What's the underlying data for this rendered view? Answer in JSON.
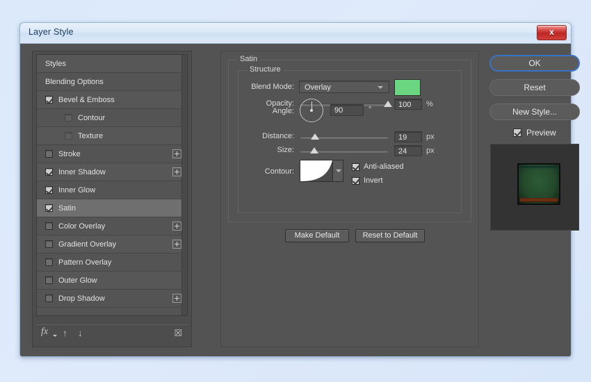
{
  "window": {
    "title": "Layer Style",
    "close_label": "x"
  },
  "styles_panel": {
    "items": [
      {
        "label": "Styles",
        "checkbox": "none",
        "indent": false,
        "plus": false,
        "selected": false
      },
      {
        "label": "Blending Options",
        "checkbox": "none",
        "indent": false,
        "plus": false,
        "selected": false
      },
      {
        "label": "Bevel & Emboss",
        "checkbox": "checked",
        "indent": false,
        "plus": false,
        "selected": false
      },
      {
        "label": "Contour",
        "checkbox": "dim",
        "indent": true,
        "plus": false,
        "selected": false
      },
      {
        "label": "Texture",
        "checkbox": "dim",
        "indent": true,
        "plus": false,
        "selected": false
      },
      {
        "label": "Stroke",
        "checkbox": "empty",
        "indent": false,
        "plus": true,
        "selected": false
      },
      {
        "label": "Inner Shadow",
        "checkbox": "checked",
        "indent": false,
        "plus": true,
        "selected": false
      },
      {
        "label": "Inner Glow",
        "checkbox": "checked",
        "indent": false,
        "plus": false,
        "selected": false
      },
      {
        "label": "Satin",
        "checkbox": "checked",
        "indent": false,
        "plus": false,
        "selected": true
      },
      {
        "label": "Color Overlay",
        "checkbox": "empty",
        "indent": false,
        "plus": true,
        "selected": false
      },
      {
        "label": "Gradient Overlay",
        "checkbox": "empty",
        "indent": false,
        "plus": true,
        "selected": false
      },
      {
        "label": "Pattern Overlay",
        "checkbox": "empty",
        "indent": false,
        "plus": false,
        "selected": false
      },
      {
        "label": "Outer Glow",
        "checkbox": "empty",
        "indent": false,
        "plus": false,
        "selected": false
      },
      {
        "label": "Drop Shadow",
        "checkbox": "empty",
        "indent": false,
        "plus": true,
        "selected": false
      }
    ],
    "toolbar": {
      "fx_label": "fx",
      "up_label": "↑",
      "down_label": "↓",
      "trash_label": "☒"
    }
  },
  "satin": {
    "group_title": "Satin",
    "structure_title": "Structure",
    "blend_mode": {
      "label": "Blend Mode:",
      "value": "Overlay",
      "color": "#6bd680"
    },
    "opacity": {
      "label": "Opacity:",
      "value": "100",
      "unit": "%",
      "percent": 100
    },
    "angle": {
      "label": "Angle:",
      "value": "90",
      "unit": "°"
    },
    "distance": {
      "label": "Distance:",
      "value": "19",
      "unit": "px",
      "percent": 17
    },
    "size": {
      "label": "Size:",
      "value": "24",
      "unit": "px",
      "percent": 16
    },
    "contour": {
      "label": "Contour:",
      "anti_aliased_label": "Anti-aliased",
      "anti_aliased_checked": true,
      "invert_label": "Invert",
      "invert_checked": true
    },
    "make_default_label": "Make Default",
    "reset_default_label": "Reset to Default"
  },
  "actions": {
    "ok_label": "OK",
    "reset_label": "Reset",
    "new_style_label": "New Style...",
    "preview_label": "Preview",
    "preview_checked": true
  }
}
